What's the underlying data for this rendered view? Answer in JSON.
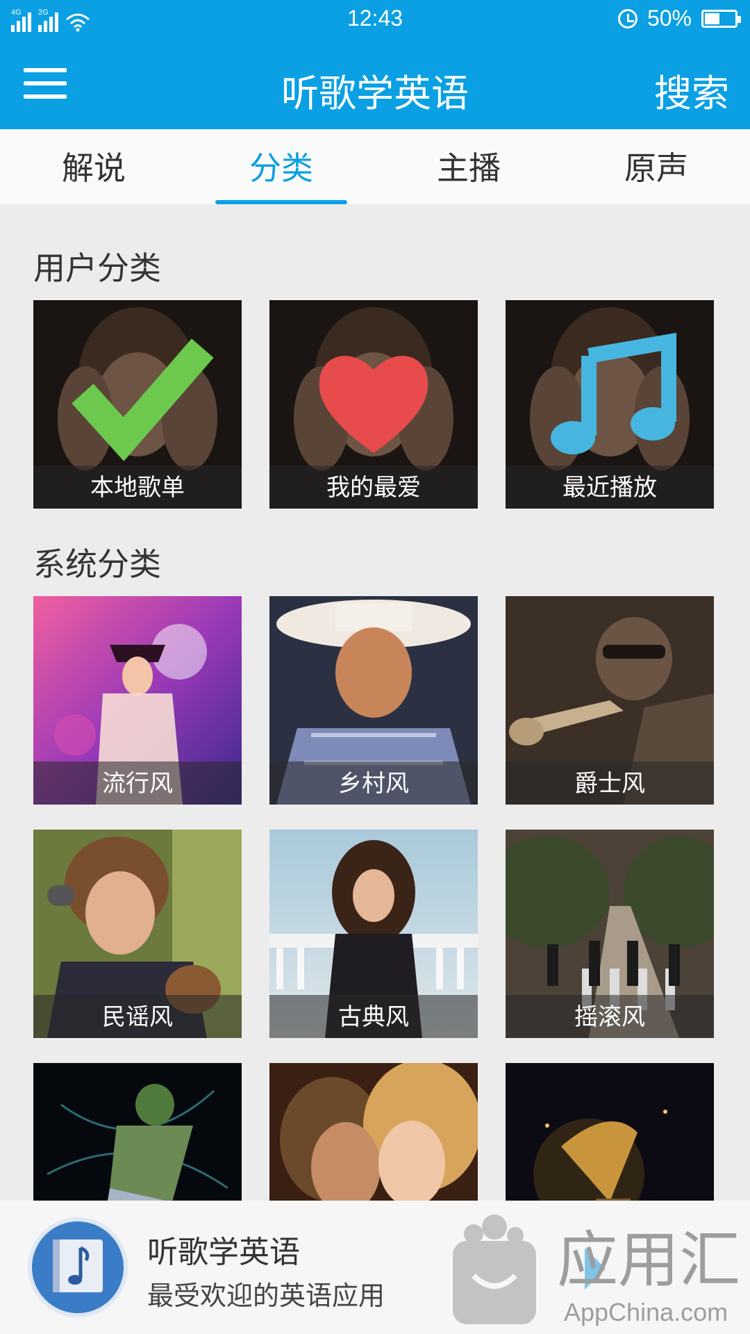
{
  "status_bar": {
    "network_1": "4G",
    "network_2": "2G",
    "time": "12:43",
    "battery": "50%",
    "battery_level": 0.5
  },
  "app_bar": {
    "menu_icon": "hamburger-menu-icon",
    "title": "听歌学英语",
    "search_label": "搜索"
  },
  "tabs": [
    {
      "label": "解说",
      "active": false
    },
    {
      "label": "分类",
      "active": true
    },
    {
      "label": "主播",
      "active": false
    },
    {
      "label": "原声",
      "active": false
    }
  ],
  "user_categories": {
    "title": "用户分类",
    "items": [
      {
        "label": "本地歌单",
        "icon": "checkmark-icon",
        "icon_color": "#6cc94e"
      },
      {
        "label": "我的最爱",
        "icon": "heart-icon",
        "icon_color": "#e84b4b"
      },
      {
        "label": "最近播放",
        "icon": "music-note-icon",
        "icon_color": "#46b6e0"
      }
    ]
  },
  "system_categories": {
    "title": "系统分类",
    "items": [
      {
        "label": "流行风",
        "image": "pop-dancer-image"
      },
      {
        "label": "乡村风",
        "image": "country-singer-image"
      },
      {
        "label": "爵士风",
        "image": "jazz-trumpet-image"
      },
      {
        "label": "民谣风",
        "image": "folk-singer-image"
      },
      {
        "label": "古典风",
        "image": "classical-singer-image"
      },
      {
        "label": "摇滚风",
        "image": "rock-beatles-image"
      },
      {
        "label": "",
        "image": "hiphop-dancer-image"
      },
      {
        "label": "",
        "image": "romance-couple-image"
      },
      {
        "label": "",
        "image": "gramophone-image"
      }
    ]
  },
  "banner": {
    "app_name": "听歌学英语",
    "app_desc": "最受欢迎的英语应用",
    "watermark_text": "应用汇",
    "watermark_sub": "AppChina.com"
  },
  "colors": {
    "accent": "#0aa0e3",
    "background": "#ececec"
  }
}
